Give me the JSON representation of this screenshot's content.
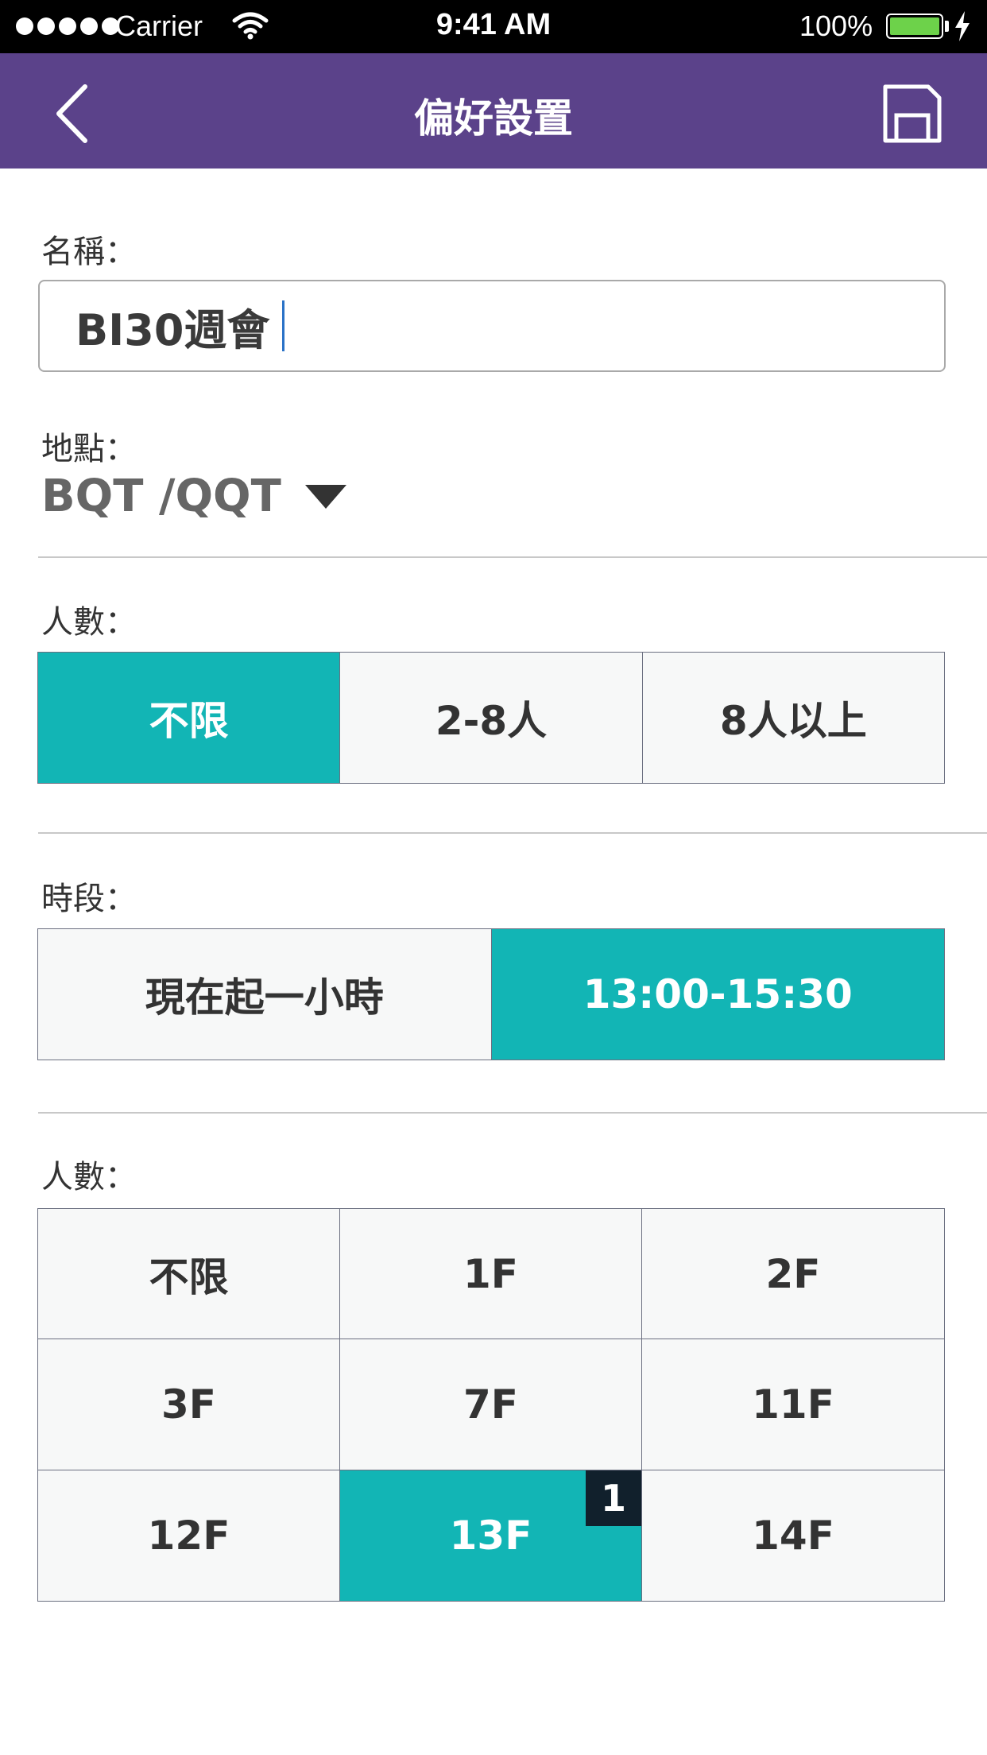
{
  "status_bar": {
    "carrier": "Carrier",
    "time": "9:41 AM",
    "battery": "100%",
    "icons": [
      "signal-dots-icon",
      "wifi-icon",
      "battery-icon",
      "charging-bolt-icon"
    ]
  },
  "nav": {
    "title": "偏好設置",
    "back_icon": "chevron-left-icon",
    "save_icon": "save-disk-icon"
  },
  "name": {
    "label": "名稱：",
    "value": "BI30週會"
  },
  "location": {
    "label": "地點：",
    "value": "BQT /QQT",
    "icon": "triangle-down-icon"
  },
  "capacity": {
    "label": "人數：",
    "options": [
      "不限",
      "2-8人",
      "8人以上"
    ],
    "selected": "不限"
  },
  "timeslot": {
    "label": "時段：",
    "options": [
      "現在起一小時",
      "13:00-15:30"
    ],
    "selected": "13:00-15:30"
  },
  "floors": {
    "label": "人數：",
    "options": [
      "不限",
      "1F",
      "2F",
      "3F",
      "7F",
      "11F",
      "12F",
      "13F",
      "14F"
    ],
    "selected": "13F",
    "badge": "1"
  },
  "colors": {
    "header": "#5b428a",
    "accent": "#12b5b5",
    "badge": "#11202c"
  }
}
